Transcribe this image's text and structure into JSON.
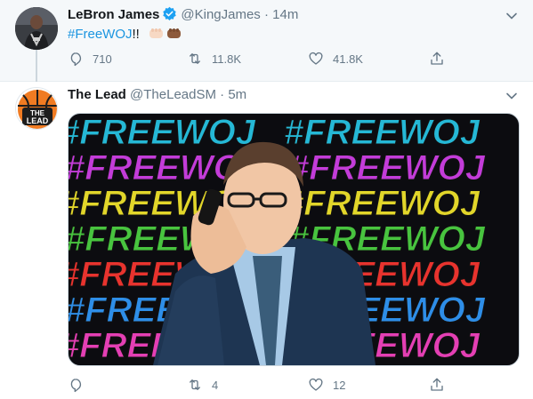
{
  "tweets": [
    {
      "name": "LeBron James",
      "verified": true,
      "handle": "@KingJames",
      "separator": "·",
      "time": "14m",
      "text_hashtag": "#FreeWOJ",
      "text_rest": "!!",
      "emoji": "fist-bump-emoji",
      "actions": {
        "replies": "710",
        "retweets": "11.8K",
        "likes": "41.8K"
      }
    },
    {
      "name": "The Lead",
      "handle": "@TheLeadSM",
      "separator": "·",
      "time": "5m",
      "avatar_text": "THE LEAD",
      "media_text": "#FREEWOJ",
      "actions": {
        "replies": "",
        "retweets": "4",
        "likes": "12"
      }
    }
  ],
  "colors": {
    "link": "#1b95e0",
    "muted": "#657786",
    "verified": "#1da1f2",
    "thread_bg": "#f5f8fa",
    "stripes": [
      "#25b8d6",
      "#c33cd9",
      "#e2d62a",
      "#48c43f",
      "#e8332e",
      "#2e8ee8",
      "#e43fb4"
    ]
  }
}
